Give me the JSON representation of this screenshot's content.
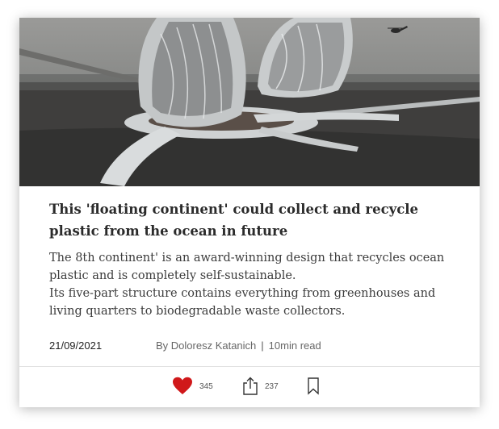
{
  "article": {
    "title": "This 'floating continent' could collect and recycle plastic from the ocean in future",
    "description_lines": [
      "The 8th continent' is an award-winning design that recycles ocean plastic and is completely self-sustainable.",
      "Its five-part structure contains everything from greenhouses and living quarters to biodegradable waste collectors."
    ],
    "date": "21/09/2021",
    "author": "By Doloresz Katanich",
    "separator": "|",
    "read_time": "10min read"
  },
  "actions": {
    "like_icon": "heart-icon",
    "like_count": "345",
    "share_icon": "share-icon",
    "share_count": "237",
    "bookmark_icon": "bookmark-icon"
  },
  "colors": {
    "heart": "#d0181a",
    "title_text": "#2b2b2b"
  }
}
